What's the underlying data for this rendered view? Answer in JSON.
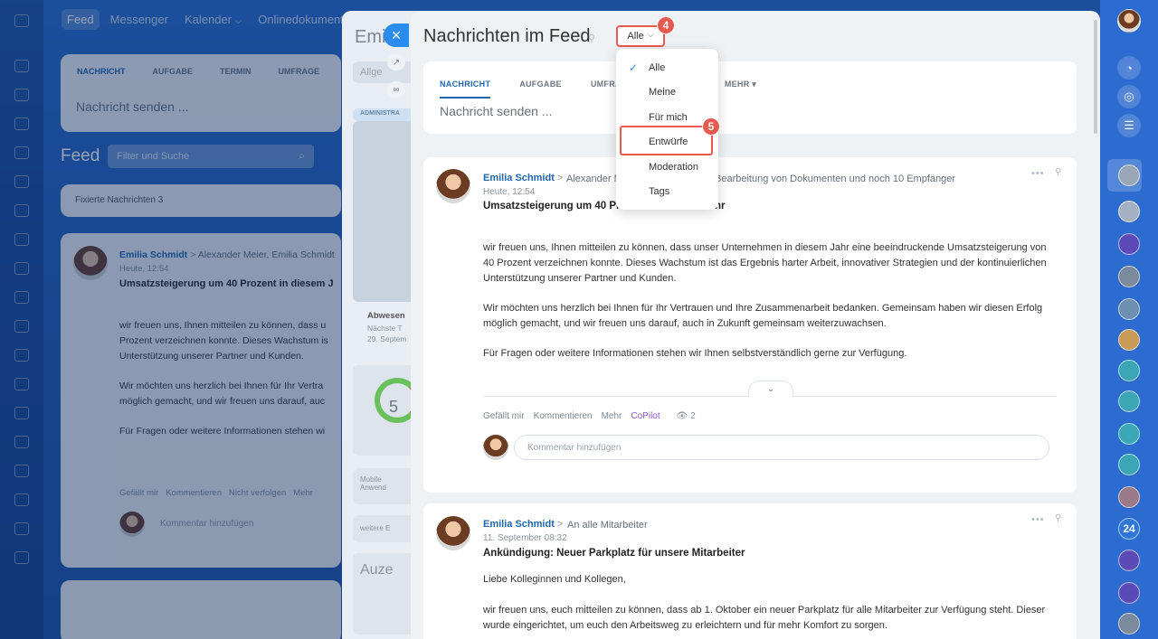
{
  "background": {
    "nav": [
      "Feed",
      "Messenger",
      "Kalender",
      "Onlinedokumente"
    ],
    "calendar_chevron": "⌵",
    "composer_tabs": [
      "NACHRICHT",
      "AUFGABE",
      "TERMIN",
      "UMFRAGE"
    ],
    "composer_placeholder": "Nachricht senden ...",
    "feed_title": "Feed",
    "filter_placeholder": "Filter und Suche",
    "pinned": "Fixierte Nachrichten 3",
    "post_author": "Emilia Schmidt",
    "post_recipients": "Alexander Meier, Emilia Schmidt",
    "post_time": "Heute, 12:54",
    "post_title": "Umsatzsteigerung um 40 Prozent in diesem J",
    "post_body": [
      "wir freuen uns, Ihnen mitteilen zu können, dass u",
      "Prozent verzeichnen konnte. Dieses Wachstum is",
      "Unterstützung unserer Partner und Kunden.",
      "Wir möchten uns herzlich bei Ihnen für Ihr Vertra",
      "möglich gemacht, und wir freuen uns darauf, auc",
      "Für Fragen oder weitere Informationen stehen wi"
    ],
    "post_actions": "Gefällt mir   Kommentieren   Nicht verfolgen   Mehr",
    "comment_placeholder": "Kommentar hinzufügen",
    "slider2_title": "Emi",
    "slider2_tab": "Allge",
    "slider2_admin": "ADMINISTRA",
    "slider2_absence": "Abwesen",
    "slider2_absence_sub1": "Nächste T",
    "slider2_absence_sub2": "29. Septem",
    "slider2_gauge_value": "5",
    "slider2_mobile": "Mobile",
    "slider2_mobile_sub": "Anwend",
    "slider2_other": "weitere E",
    "slider2_bottom": "Auze"
  },
  "slider": {
    "title": "Nachrichten im Feed",
    "pin_icon": "pin-icon",
    "filter_label": "Alle",
    "filter_chevron": "⌵",
    "badge_filter": "4",
    "badge_drafts": "5",
    "close_icon": "✕",
    "tabs": [
      "NACHRICHT",
      "AUFGABE",
      "UMFRA",
      "MEHR ▾"
    ],
    "composer_placeholder": "Nachricht senden ..."
  },
  "dropdown": {
    "check": "✓",
    "items": [
      "Alle",
      "Meine",
      "Für mich",
      "Entwürfe",
      "Moderation",
      "Tags"
    ]
  },
  "post1": {
    "author": "Emilia Schmidt",
    "arrow": ">",
    "recipients_left": "Alexander M",
    "recipients_right": "Bearbeitung von Dokumenten  und noch 10 Empfänger",
    "time": "Heute, 12:54",
    "title": "Umsatzsteigerung um 40 Pro",
    "title_tail": "hr",
    "body1": "wir freuen uns, Ihnen mitteilen zu können, dass unser Unternehmen in diesem Jahr eine beeindruckende Umsatzsteigerung von 40 Prozent verzeichnen konnte. Dieses Wachstum ist das Ergebnis harter Arbeit, innovativer Strategien und der kontinuierlichen Unterstützung unserer Partner und Kunden.",
    "body2": "Wir möchten uns herzlich bei Ihnen für Ihr Vertrauen und Ihre Zusammenarbeit bedanken. Gemeinsam haben wir diesen Erfolg möglich gemacht, und wir freuen uns darauf, auch in Zukunft gemeinsam weiterzuwachsen.",
    "body3": "Für Fragen oder weitere Informationen stehen wir Ihnen selbstverständlich gerne zur Verfügung.",
    "expand": "⌄",
    "like": "Gefällt mir",
    "comment": "Kommentieren",
    "more": "Mehr",
    "copilot": "CoPilot",
    "views": "👁 2",
    "comment_placeholder": "Kommentar hinzufügen",
    "menu": "•••",
    "pin": "📌"
  },
  "post2": {
    "author": "Emilia Schmidt",
    "arrow": ">",
    "recipients": "An alle Mitarbeiter",
    "time": "11. September 08:32",
    "title": "Ankündigung: Neuer Parkplatz für unsere Mitarbeiter",
    "greeting": "Liebe Kolleginnen und Kollegen,",
    "body": "wir freuen uns, euch mitteilen zu können, dass ab 1. Oktober ein neuer Parkplatz für alle Mitarbeiter zur Verfügung steht. Dieser wurde eingerichtet, um euch den Arbeitsweg zu erleichtern und für mehr Komfort zu sorgen.",
    "menu": "•••",
    "pin": "📌"
  },
  "right_rail": {
    "counter": "24",
    "icons": [
      "bell-icon",
      "target-icon",
      "chat-icon"
    ]
  },
  "colors": {
    "accent": "#2067b0",
    "highlight": "#e85a4f",
    "copilot": "#8a57d8",
    "close_button": "#2b8cf0"
  }
}
